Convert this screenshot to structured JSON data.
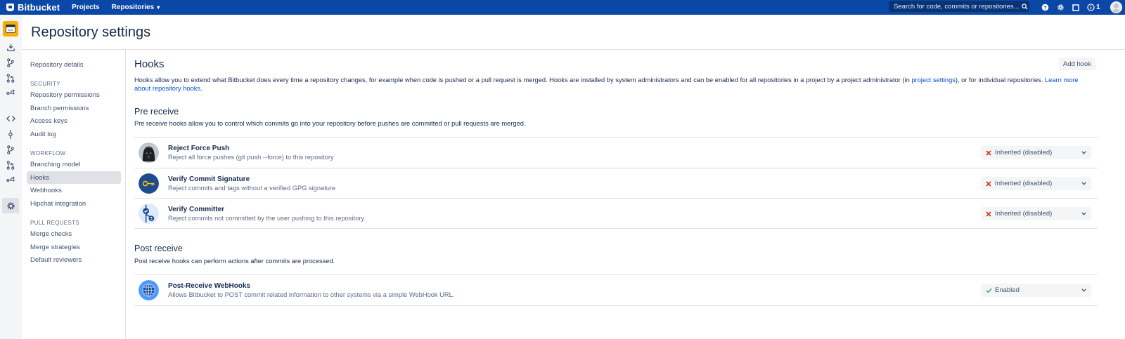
{
  "topnav": {
    "brand": "Bitbucket",
    "links": [
      {
        "label": "Projects"
      },
      {
        "label": "Repositories"
      }
    ],
    "search_placeholder": "Search for code, commits or repositories...",
    "notifications_count": "1",
    "icons": [
      "help-icon",
      "settings-icon",
      "tasks-icon",
      "info-icon",
      "avatar"
    ]
  },
  "rail": {
    "items": [
      "repository-icon",
      "clone-icon",
      "create-branch-icon",
      "create-pull-request-icon",
      "create-fork-icon",
      "source-icon",
      "commits-icon",
      "branches-icon",
      "pull-requests-icon",
      "forks-icon",
      "settings-icon"
    ]
  },
  "page": {
    "title": "Repository settings"
  },
  "settings_nav": {
    "repository_details": "Repository details",
    "security_heading": "SECURITY",
    "security_items": [
      "Repository permissions",
      "Branch permissions",
      "Access keys",
      "Audit log"
    ],
    "workflow_heading": "WORKFLOW",
    "workflow_items": [
      "Branching model",
      "Hooks",
      "Webhooks",
      "Hipchat integration"
    ],
    "pull_requests_heading": "PULL REQUESTS",
    "pull_requests_items": [
      "Merge checks",
      "Merge strategies",
      "Default reviewers"
    ],
    "active_item": "Hooks"
  },
  "main": {
    "title": "Hooks",
    "add_hook_label": "Add hook",
    "description_part1": "Hooks allow you to extend what Bitbucket does every time a repository changes, for example when code is pushed or a pull request is merged. Hooks are installed by system administrators and can be enabled for all repositories in a project by a project administrator (in ",
    "project_settings_link": "project settings",
    "description_part2": "), or for individual repositories. ",
    "learn_more_link": "Learn more about repository hooks",
    "description_end": ".",
    "pre_receive": {
      "title": "Pre receive",
      "description": "Pre receive hooks allow you to control which commits go into your repository before pushes are committed or pull requests are merged.",
      "hooks": [
        {
          "name": "Reject Force Push",
          "description": "Reject all force pushes (git push --force) to this repository",
          "status": "Inherited (disabled)",
          "icon": "darth-vader-icon"
        },
        {
          "name": "Verify Commit Signature",
          "description": "Reject commits and tags without a verified GPG signature",
          "status": "Inherited (disabled)",
          "icon": "key-icon"
        },
        {
          "name": "Verify Committer",
          "description": "Reject commits not committed by the user pushing to this repository",
          "status": "Inherited (disabled)",
          "icon": "verify-committer-icon"
        }
      ]
    },
    "post_receive": {
      "title": "Post receive",
      "description": "Post receive hooks can perform actions after commits are processed.",
      "hooks": [
        {
          "name": "Post-Receive WebHooks",
          "description": "Allows Bitbucket to POST commit related information to other systems via a simple WebHook URL.",
          "status": "Enabled",
          "icon": "globe-icon"
        }
      ]
    }
  },
  "colors": {
    "nav_blue": "#0b47a6",
    "repo_avatar": "#ffab00",
    "link": "#0052cc",
    "disabled_x": "#de350b",
    "enabled_check": "#36b37e"
  }
}
